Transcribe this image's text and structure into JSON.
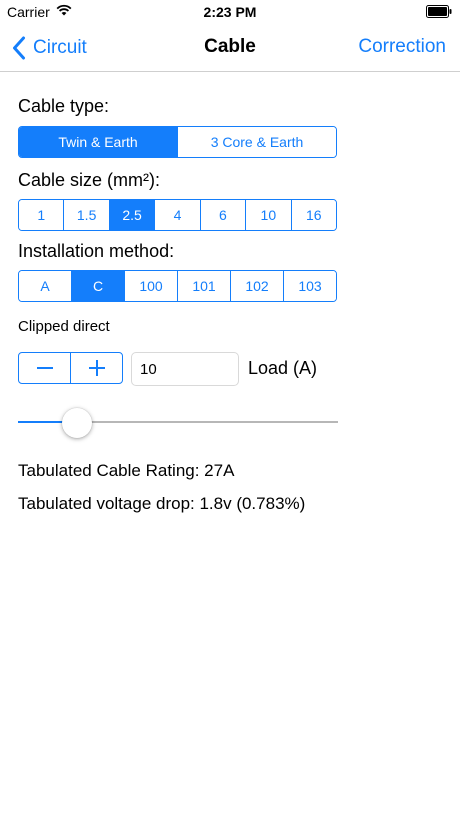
{
  "status_bar": {
    "carrier": "Carrier",
    "time": "2:23 PM"
  },
  "nav": {
    "back_label": "Circuit",
    "title": "Cable",
    "right_label": "Correction"
  },
  "cable_type": {
    "label": "Cable type:",
    "options": [
      "Twin & Earth",
      "3 Core & Earth"
    ],
    "selected": "Twin & Earth"
  },
  "cable_size": {
    "label": "Cable size (mm²):",
    "options": [
      "1",
      "1.5",
      "2.5",
      "4",
      "6",
      "10",
      "16"
    ],
    "selected": "2.5"
  },
  "installation": {
    "label": "Installation method:",
    "options": [
      "A",
      "C",
      "100",
      "101",
      "102",
      "103"
    ],
    "selected": "C",
    "description": "Clipped direct"
  },
  "load": {
    "value": "10",
    "label": "Load (A)",
    "slider_fraction": 0.15
  },
  "results": {
    "rating": "Tabulated Cable Rating: 27A",
    "voltage_drop": "Tabulated voltage drop: 1.8v (0.783%)"
  },
  "colors": {
    "accent": "#147efb"
  },
  "icons": {
    "back": "chevron-left-icon",
    "wifi": "wifi-icon",
    "battery": "battery-icon",
    "minus": "minus-icon",
    "plus": "plus-icon"
  }
}
